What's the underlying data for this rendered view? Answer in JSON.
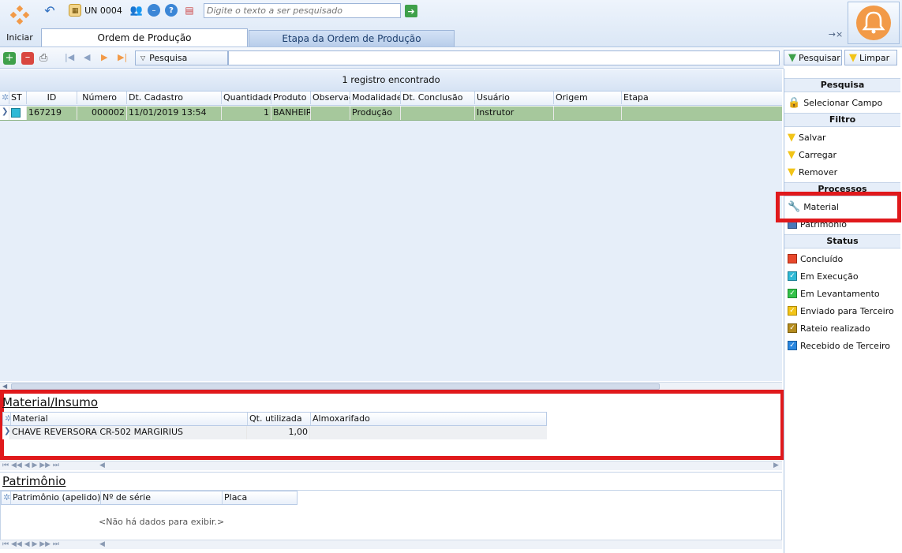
{
  "toolbar": {
    "home_label": "Iniciar",
    "unit": "UN 0004",
    "search_placeholder": "Digite o texto a ser pesquisado"
  },
  "tabs": [
    {
      "label": "Ordem de Produção"
    },
    {
      "label": "Etapa da Ordem de Produção"
    }
  ],
  "tab_controls": "→×",
  "actions": {
    "search_field": "Pesquisa",
    "pesquisar": "Pesquisar",
    "limpar": "Limpar"
  },
  "main_grid": {
    "status": "1 registro encontrado",
    "columns": [
      "ST",
      "ID",
      "Número",
      "Dt. Cadastro",
      "Quantidade",
      "Produto",
      "Observaç",
      "Modalidade",
      "Dt. Conclusão",
      "Usuário",
      "Origem",
      "Etapa"
    ],
    "row": {
      "id": "167219",
      "numero": "000002",
      "dt_cadastro": "11/01/2019 13:54",
      "quantidade": "1",
      "produto": "BANHEIR(",
      "observacao": "",
      "modalidade": "Produção",
      "dt_conclusao": "",
      "usuario": "Instrutor",
      "origem": "",
      "etapa": ""
    }
  },
  "material": {
    "title": "Material/Insumo",
    "columns": [
      "Material",
      "Qt. utilizada",
      "Almoxarifado"
    ],
    "row": {
      "material": "CHAVE REVERSORA CR-502 MARGIRIUS",
      "qt": "1,00",
      "almox": ""
    }
  },
  "patrimonio": {
    "title": "Patrimônio",
    "columns": [
      "Patrimônio (apelido)",
      "Nº de série",
      "Placa"
    ],
    "empty": "<Não há dados para exibir.>"
  },
  "sidebar": {
    "pesquisa": {
      "title": "Pesquisa",
      "items": [
        "Selecionar Campo"
      ]
    },
    "filtro": {
      "title": "Filtro",
      "items": [
        "Salvar",
        "Carregar",
        "Remover"
      ]
    },
    "processos": {
      "title": "Processos",
      "items": [
        "Material",
        "Patrimônio"
      ]
    },
    "status": {
      "title": "Status",
      "items": [
        {
          "label": "Concluído",
          "color": "#e8482c"
        },
        {
          "label": "Em Execução",
          "color": "#2fb9d6"
        },
        {
          "label": "Em Levantamento",
          "color": "#34c24a"
        },
        {
          "label": "Enviado para Terceiro",
          "color": "#f2c418"
        },
        {
          "label": "Rateio realizado",
          "color": "#b58c1e"
        },
        {
          "label": "Recebido de Terceiro",
          "color": "#2a87e0"
        }
      ]
    }
  },
  "colors": {
    "accent": "#e0191c",
    "row_selected": "#a6c89c",
    "bell": "#f29a48"
  }
}
